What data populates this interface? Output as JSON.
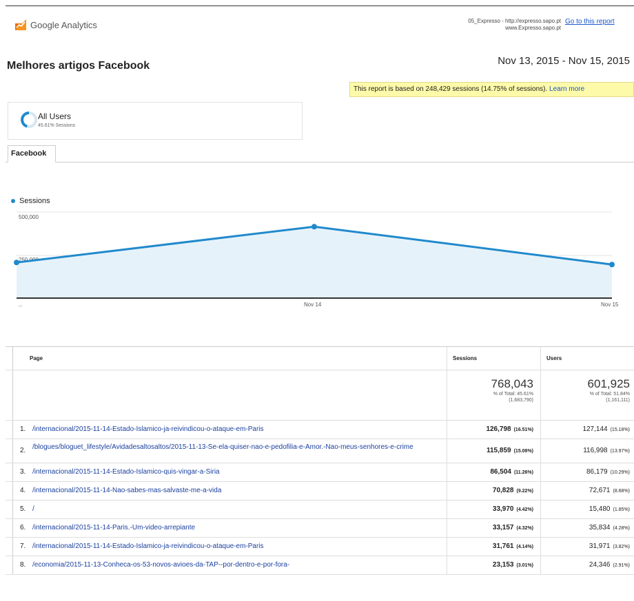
{
  "header": {
    "logo_text": "Google Analytics",
    "site_line1": "05_Expresso - http://expresso.sapo.pt",
    "site_line2": "www.Expresso.sapo.pt",
    "goto_link": "Go to this report"
  },
  "report": {
    "title": "Melhores artigos Facebook",
    "date_range": "Nov 13, 2015 - Nov 15, 2015",
    "notice_text": "This report is based on 248,429 sessions (14.75% of sessions).",
    "notice_link": "Learn more"
  },
  "segment": {
    "name": "All Users",
    "pct": "45.61% Sessions"
  },
  "tab": {
    "label": "Facebook"
  },
  "chart_data": {
    "type": "line",
    "legend": "Sessions",
    "x_ticks": [
      "...",
      "Nov 14",
      "Nov 15"
    ],
    "y_ticks": [
      "500,000",
      "250,000"
    ],
    "x": [
      "Nov 13",
      "Nov 14",
      "Nov 15"
    ],
    "series": [
      {
        "name": "Sessions",
        "values": [
          207000,
          415000,
          195000
        ]
      }
    ],
    "ylim": [
      0,
      500000
    ],
    "colors": {
      "line": "#2089cc",
      "fill": "#e6f2fa"
    }
  },
  "table": {
    "headers": {
      "page": "Page",
      "sessions": "Sessions",
      "users": "Users"
    },
    "totals": {
      "sessions": "768,043",
      "sessions_pct": "% of Total: 45.61%",
      "sessions_base": "(1,683,790)",
      "users": "601,925",
      "users_pct": "% of Total: 51.84%",
      "users_base": "(1,161,111)"
    },
    "rows": [
      {
        "idx": "1.",
        "page": "/internacional/2015-11-14-Estado-Islamico-ja-reivindicou-o-ataque-em-Paris",
        "sessions": "126,798",
        "sessions_pct": "(16.51%)",
        "users": "127,144",
        "users_pct": "(15.18%)"
      },
      {
        "idx": "2.",
        "page": "/blogues/bloguet_lifestyle/Avidadesaltosaltos/2015-11-13-Se-ela-quiser-nao-e-pedofilia-e-Amor.-Nao-meus-senhores-e-crime",
        "sessions": "115,859",
        "sessions_pct": "(15.08%)",
        "users": "116,998",
        "users_pct": "(13.97%)"
      },
      {
        "idx": "3.",
        "page": "/internacional/2015-11-14-Estado-Islamico-quis-vingar-a-Siria",
        "sessions": "86,504",
        "sessions_pct": "(11.26%)",
        "users": "86,179",
        "users_pct": "(10.29%)"
      },
      {
        "idx": "4.",
        "page": "/internacional/2015-11-14-Nao-sabes-mas-salvaste-me-a-vida",
        "sessions": "70,828",
        "sessions_pct": "(9.22%)",
        "users": "72,671",
        "users_pct": "(8.68%)"
      },
      {
        "idx": "5.",
        "page": "/",
        "sessions": "33,970",
        "sessions_pct": "(4.42%)",
        "users": "15,480",
        "users_pct": "(1.85%)"
      },
      {
        "idx": "6.",
        "page": "/internacional/2015-11-14-Paris.-Um-video-arrepiante",
        "sessions": "33,157",
        "sessions_pct": "(4.32%)",
        "users": "35,834",
        "users_pct": "(4.28%)"
      },
      {
        "idx": "7.",
        "page": "/internacional/2015-11-14-Estado-Islamico-ja-reivindicou-o-ataque-em-Paris",
        "sessions": "31,761",
        "sessions_pct": "(4.14%)",
        "users": "31,971",
        "users_pct": "(3.82%)"
      },
      {
        "idx": "8.",
        "page": "/economia/2015-11-13-Conheca-os-53-novos-avioes-da-TAP--por-dentro-e-por-fora-",
        "sessions": "23,153",
        "sessions_pct": "(3.01%)",
        "users": "24,346",
        "users_pct": "(2.91%)"
      }
    ]
  }
}
